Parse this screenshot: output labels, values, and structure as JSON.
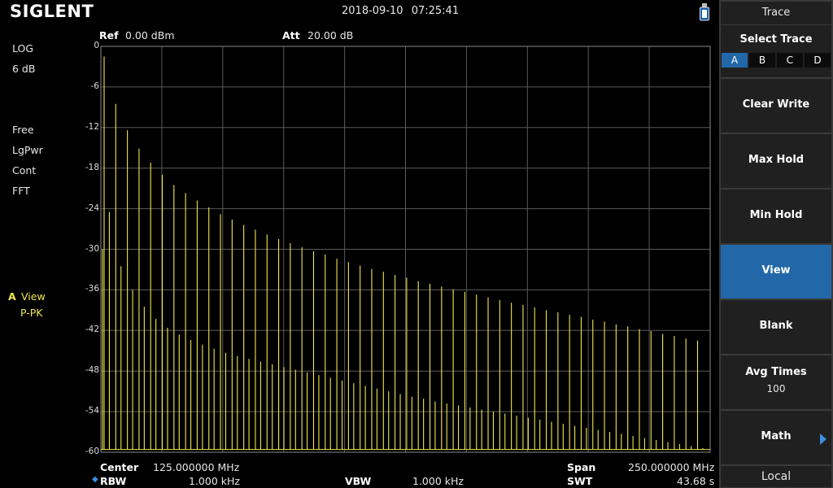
{
  "header": {
    "brand": "SIGLENT",
    "date": "2018-09-10",
    "time": "07:25:41"
  },
  "left_status": {
    "scale_type": "LOG",
    "scale_div": "6 dB",
    "trigger": "Free",
    "avg_type": "LgPwr",
    "sweep_mode": "Cont",
    "sweep_type": "FFT",
    "trace_letter": "A",
    "trace_state": "View",
    "detector": "P-PK"
  },
  "plot_header": {
    "ref_label": "Ref",
    "ref_value": "0.00 dBm",
    "att_label": "Att",
    "att_value": "20.00 dB"
  },
  "y_ticks": [
    "0",
    "-6",
    "-12",
    "-18",
    "-24",
    "-30",
    "-36",
    "-42",
    "-48",
    "-54",
    "-60"
  ],
  "bottom": {
    "center_label": "Center",
    "center_value": "125.000000 MHz",
    "span_label": "Span",
    "span_value": "250.000000 MHz",
    "rbw_label": "RBW",
    "rbw_value": "1.000 kHz",
    "vbw_label": "VBW",
    "vbw_value": "1.000 kHz",
    "swt_label": "SWT",
    "swt_value": "43.68 s"
  },
  "menu": {
    "title": "Trace",
    "select_trace_label": "Select Trace",
    "trace_options": [
      "A",
      "B",
      "C",
      "D"
    ],
    "selected_trace": "A",
    "clear_write": "Clear Write",
    "max_hold": "Max Hold",
    "min_hold": "Min Hold",
    "view": "View",
    "blank": "Blank",
    "avg_times_label": "Avg Times",
    "avg_times_value": "100",
    "math": "Math",
    "local": "Local"
  },
  "colors": {
    "trace": "#f0e84c",
    "active_key": "#2268a8",
    "grid": "#5a5a5a"
  },
  "chart_data": {
    "type": "line",
    "ylim": [
      -60,
      0
    ],
    "yunit": "dBm",
    "xlim_mhz": [
      0,
      250
    ],
    "series": [
      {
        "peaks_x_mhz": [
          0,
          4.8,
          9.6,
          14.4,
          19.2,
          24,
          28.8,
          33.6,
          38.4,
          43.2,
          48,
          52.8,
          57.6,
          62.4,
          67.2,
          72,
          76.8,
          81.6,
          86.4,
          91.2,
          96,
          100.8,
          105.6,
          110.4,
          115.2,
          120,
          124.8,
          129.6,
          134.4,
          139.2,
          144,
          148.8,
          153.6,
          158.4,
          163.2,
          168,
          172.8,
          177.6,
          182.4,
          187.2,
          192,
          196.8,
          201.6,
          206.4,
          211.2,
          216,
          220.8,
          225.6,
          230.4,
          235.2,
          240,
          244.8
        ],
        "major_peaks_dbm": [
          -1.5,
          -8.5,
          -12.4,
          -15.1,
          -17.2,
          -19.0,
          -20.5,
          -21.7,
          -22.8,
          -23.8,
          -24.8,
          -25.6,
          -26.4,
          -27.1,
          -27.8,
          -28.5,
          -29.1,
          -29.7,
          -30.3,
          -30.8,
          -31.4,
          -31.9,
          -32.4,
          -32.9,
          -33.3,
          -33.8,
          -34.2,
          -34.7,
          -35.1,
          -35.5,
          -35.9,
          -36.3,
          -36.7,
          -37.1,
          -37.5,
          -37.9,
          -38.2,
          -38.6,
          -39.0,
          -39.3,
          -39.7,
          -40.0,
          -40.4,
          -40.7,
          -41.1,
          -41.4,
          -41.8,
          -42.1,
          -42.5,
          -42.8,
          -43.2,
          -43.5
        ],
        "minor_peaks_dbm": [
          -24.5,
          -32.5,
          -36.0,
          -38.5,
          -40.3,
          -41.6,
          -42.6,
          -43.4,
          -44.1,
          -44.7,
          -45.3,
          -45.8,
          -46.2,
          -46.6,
          -47.0,
          -47.4,
          -47.8,
          -48.2,
          -48.6,
          -49.0,
          -49.4,
          -49.8,
          -50.2,
          -50.6,
          -51.0,
          -51.4,
          -51.8,
          -52.1,
          -52.5,
          -52.8,
          -53.1,
          -53.4,
          -53.7,
          -54.0,
          -54.3,
          -54.6,
          -54.9,
          -55.2,
          -55.5,
          -55.8,
          -56.1,
          -56.4,
          -56.7,
          -57.0,
          -57.3,
          -57.6,
          -57.9,
          -58.2,
          -58.5,
          -58.8,
          -59.1,
          -59.4
        ]
      }
    ]
  }
}
